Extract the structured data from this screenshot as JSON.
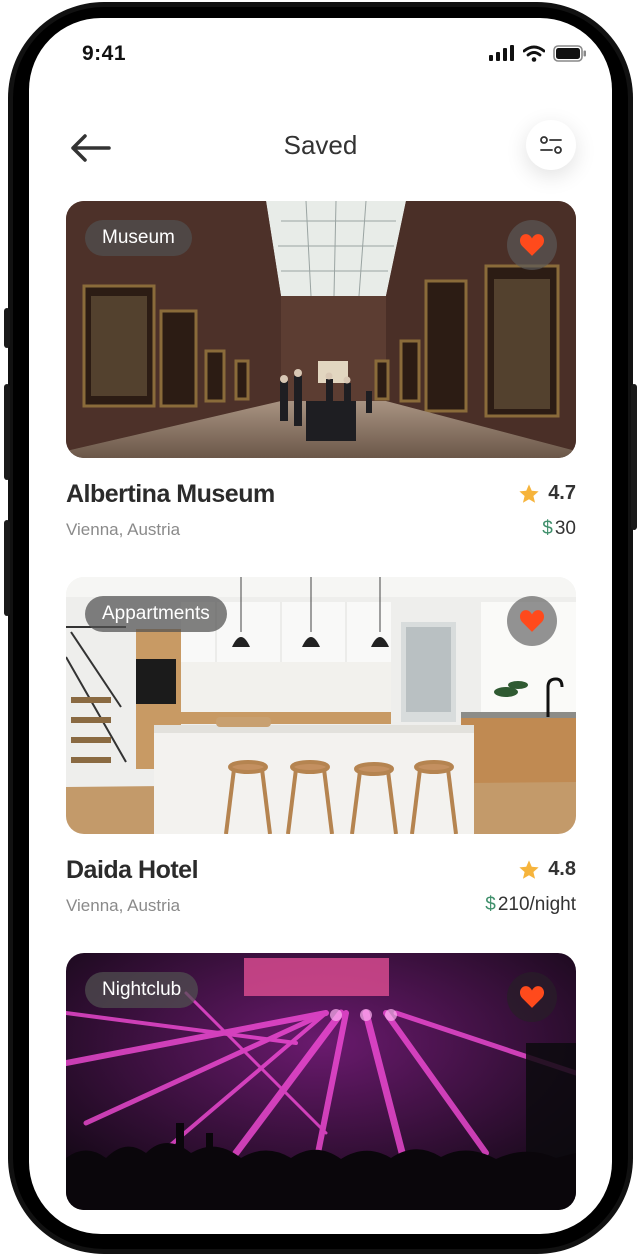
{
  "status": {
    "time": "9:41"
  },
  "header": {
    "title": "Saved"
  },
  "places": [
    {
      "category": "Museum",
      "name": "Albertina Museum",
      "location": "Vienna, Austria",
      "rating": "4.7",
      "currency": "$",
      "price": "30"
    },
    {
      "category": "Appartments",
      "name": "Daida Hotel",
      "location": "Vienna, Austria",
      "rating": "4.8",
      "currency": "$",
      "price": "210/night"
    },
    {
      "category": "Nightclub"
    }
  ],
  "colors": {
    "accent": "#ff4a1c",
    "star": "#f6b43c",
    "price_symbol": "#3f8f6b",
    "text": "#2b2b2b",
    "muted": "#8a8a8a"
  },
  "icons": {
    "back": "arrow-left-icon",
    "filter": "sliders-icon",
    "favorite": "heart-icon",
    "rating": "star-icon"
  }
}
